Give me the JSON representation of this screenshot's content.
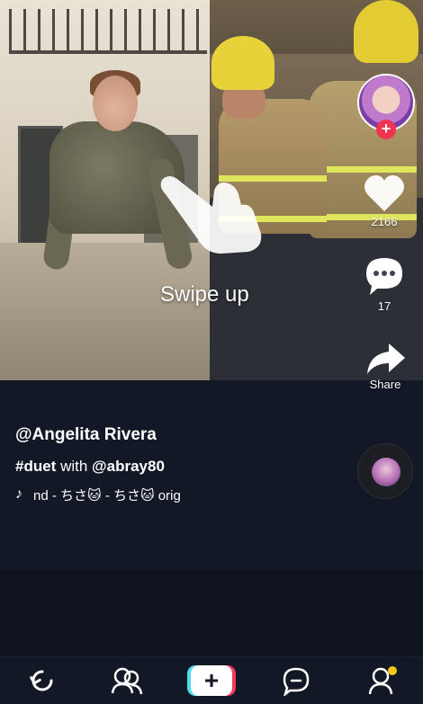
{
  "overlay": {
    "swipe_hint": "Swipe up"
  },
  "actions": {
    "likes": "2166",
    "comments": "17",
    "share_label": "Share"
  },
  "caption": {
    "username": "@Angelita Rivera",
    "hashtag": "#duet",
    "with_text": "with",
    "mention": "@abray80",
    "music": "nd - ちさ🐱 - ちさ🐱    orig"
  },
  "icons": {
    "follow": "plus-icon",
    "like": "heart-icon",
    "comment": "comment-icon",
    "share": "share-arrow-icon",
    "music": "music-note-icon",
    "nav": [
      "refresh-icon",
      "friends-icon",
      "create-icon",
      "inbox-icon",
      "profile-icon"
    ]
  },
  "colors": {
    "background": "#131826",
    "follow_red": "#f0334f",
    "notification_yellow": "#f5c71a",
    "create_cyan": "#4fdcec",
    "create_pink": "#f2385b"
  }
}
